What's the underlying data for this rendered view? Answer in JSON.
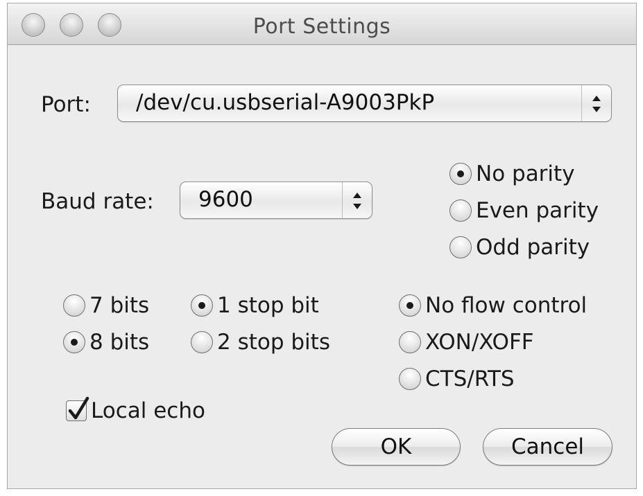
{
  "window": {
    "title": "Port Settings"
  },
  "port": {
    "label": "Port:",
    "value": "/dev/cu.usbserial-A9003PkP"
  },
  "baud": {
    "label": "Baud rate:",
    "value": "9600"
  },
  "parity": {
    "options": [
      {
        "label": "No parity",
        "selected": true
      },
      {
        "label": "Even parity",
        "selected": false
      },
      {
        "label": "Odd parity",
        "selected": false
      }
    ]
  },
  "data_bits": {
    "options": [
      {
        "label": "7 bits",
        "selected": false
      },
      {
        "label": "8 bits",
        "selected": true
      }
    ]
  },
  "stop_bits": {
    "options": [
      {
        "label": "1 stop bit",
        "selected": true
      },
      {
        "label": "2 stop bits",
        "selected": false
      }
    ]
  },
  "flow_control": {
    "options": [
      {
        "label": "No flow control",
        "selected": true
      },
      {
        "label": "XON/XOFF",
        "selected": false
      },
      {
        "label": "CTS/RTS",
        "selected": false
      }
    ]
  },
  "local_echo": {
    "label": "Local echo",
    "checked": true
  },
  "buttons": {
    "ok": "OK",
    "cancel": "Cancel"
  }
}
